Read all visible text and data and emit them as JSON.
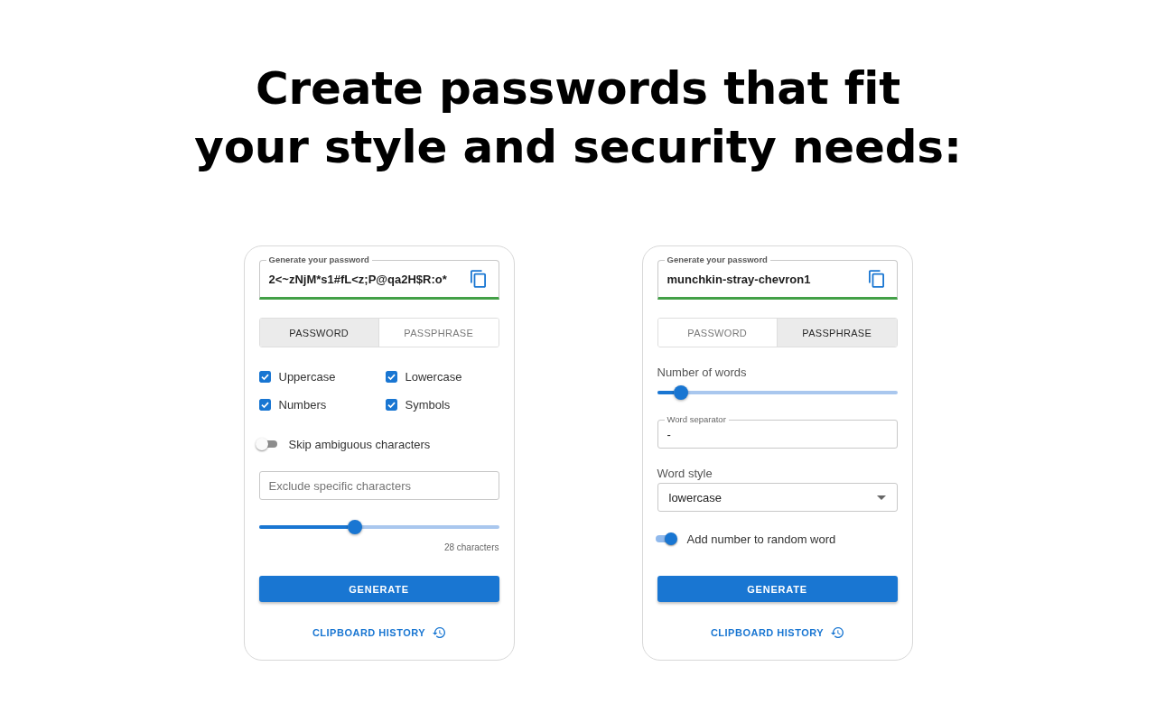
{
  "headline": {
    "lines": [
      "Create passwords that fit",
      "your style and security needs:"
    ]
  },
  "cards": [
    {
      "password_field": {
        "label": "Generate your password",
        "value": "2<~zNjM*s1#fL<z;P@qa2H$R:o*"
      },
      "tabs": [
        {
          "label": "PASSWORD",
          "selected": true
        },
        {
          "label": "PASSPHRASE",
          "selected": false
        }
      ],
      "options": [
        {
          "kind": "checkboxes",
          "items": [
            {
              "label": "Uppercase",
              "checked": true
            },
            {
              "label": "Lowercase",
              "checked": true
            },
            {
              "label": "Numbers",
              "checked": true
            },
            {
              "label": "Symbols",
              "checked": true
            }
          ]
        },
        {
          "kind": "toggle",
          "label": "Skip ambiguous characters",
          "on": false
        },
        {
          "kind": "text_field",
          "placeholder": "Exclude specific characters"
        },
        {
          "kind": "slider",
          "level": 0.4,
          "reading": "28 characters"
        }
      ],
      "generate_button": "GENERATE",
      "history_link": "CLIPBOARD HISTORY"
    },
    {
      "password_field": {
        "label": "Generate your password",
        "value": "munchkin-stray-chevron1"
      },
      "tabs": [
        {
          "label": "PASSWORD",
          "selected": false
        },
        {
          "label": "PASSPHRASE",
          "selected": true
        }
      ],
      "options": [
        {
          "kind": "slider",
          "label": "Number of words",
          "level": 0.1
        },
        {
          "kind": "labeled_field",
          "label": "Word separator",
          "value": "-"
        },
        {
          "kind": "select",
          "label": "Word style",
          "value": "lowercase"
        },
        {
          "kind": "toggle",
          "label": "Add number to random word",
          "on": true
        }
      ],
      "generate_button": "GENERATE",
      "history_link": "CLIPBOARD HISTORY"
    }
  ]
}
